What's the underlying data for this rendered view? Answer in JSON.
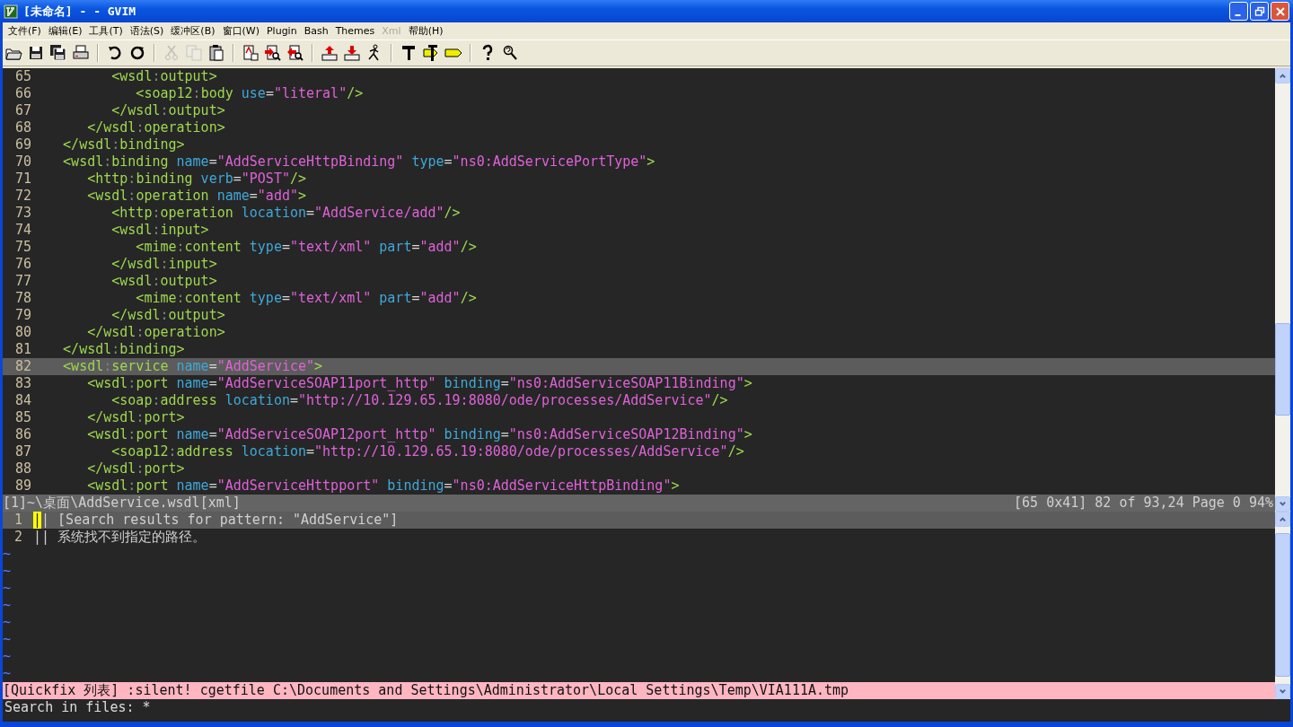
{
  "window": {
    "title": "[未命名] - - GVIM"
  },
  "menu": [
    {
      "label": "文件(F)",
      "disabled": false
    },
    {
      "label": "编辑(E)",
      "disabled": false
    },
    {
      "label": "工具(T)",
      "disabled": false
    },
    {
      "label": "语法(S)",
      "disabled": false
    },
    {
      "label": "缓冲区(B)",
      "disabled": false
    },
    {
      "label": "窗口(W)",
      "disabled": false
    },
    {
      "label": "Plugin",
      "disabled": false
    },
    {
      "label": "Bash",
      "disabled": false
    },
    {
      "label": "Themes",
      "disabled": false
    },
    {
      "label": "Xml",
      "disabled": true
    },
    {
      "label": "帮助(H)",
      "disabled": false
    }
  ],
  "toolbar": [
    {
      "kind": "folder",
      "disabled": false
    },
    {
      "kind": "floppy",
      "disabled": false
    },
    {
      "kind": "floppies",
      "disabled": false
    },
    {
      "kind": "printer",
      "disabled": false
    },
    {
      "kind": "sep"
    },
    {
      "kind": "undo",
      "disabled": false
    },
    {
      "kind": "redo",
      "disabled": false
    },
    {
      "kind": "sep"
    },
    {
      "kind": "scissors",
      "disabled": true
    },
    {
      "kind": "copy",
      "disabled": true
    },
    {
      "kind": "clipboard",
      "disabled": false
    },
    {
      "kind": "sep"
    },
    {
      "kind": "replace",
      "disabled": false
    },
    {
      "kind": "findnext",
      "disabled": false
    },
    {
      "kind": "findprev",
      "disabled": false
    },
    {
      "kind": "sep"
    },
    {
      "kind": "upload",
      "disabled": false
    },
    {
      "kind": "download",
      "disabled": false
    },
    {
      "kind": "runner",
      "disabled": false
    },
    {
      "kind": "sep"
    },
    {
      "kind": "hammer",
      "disabled": false
    },
    {
      "kind": "taghammer",
      "disabled": false
    },
    {
      "kind": "tag",
      "disabled": false
    },
    {
      "kind": "sep"
    },
    {
      "kind": "help",
      "disabled": false
    },
    {
      "kind": "findhelp",
      "disabled": false
    }
  ],
  "editor": {
    "lines": [
      {
        "num": "65",
        "current": false,
        "tokens": [
          {
            "kind": "tag",
            "t": "         <wsdl"
          },
          {
            "kind": "ns",
            "t": ":"
          },
          {
            "kind": "tag",
            "t": "output>"
          }
        ]
      },
      {
        "num": "66",
        "current": false,
        "tokens": [
          {
            "kind": "tag",
            "t": "            <soap12"
          },
          {
            "kind": "ns",
            "t": ":"
          },
          {
            "kind": "tag",
            "t": "body"
          },
          {
            "kind": "attr",
            "t": " use"
          },
          {
            "kind": "eq",
            "t": "="
          },
          {
            "kind": "str",
            "t": "\"literal\""
          },
          {
            "kind": "tag",
            "t": "/>"
          }
        ]
      },
      {
        "num": "67",
        "current": false,
        "tokens": [
          {
            "kind": "tag",
            "t": "         </wsdl"
          },
          {
            "kind": "ns",
            "t": ":"
          },
          {
            "kind": "tag",
            "t": "output>"
          }
        ]
      },
      {
        "num": "68",
        "current": false,
        "tokens": [
          {
            "kind": "tag",
            "t": "      </wsdl"
          },
          {
            "kind": "ns",
            "t": ":"
          },
          {
            "kind": "tag",
            "t": "operation>"
          }
        ]
      },
      {
        "num": "69",
        "current": false,
        "tokens": [
          {
            "kind": "tag",
            "t": "   </wsdl"
          },
          {
            "kind": "ns",
            "t": ":"
          },
          {
            "kind": "tag",
            "t": "binding>"
          }
        ]
      },
      {
        "num": "70",
        "current": false,
        "tokens": [
          {
            "kind": "tag",
            "t": "   <wsdl"
          },
          {
            "kind": "ns",
            "t": ":"
          },
          {
            "kind": "tag",
            "t": "binding"
          },
          {
            "kind": "attr",
            "t": " name"
          },
          {
            "kind": "eq",
            "t": "="
          },
          {
            "kind": "str",
            "t": "\"AddServiceHttpBinding\""
          },
          {
            "kind": "attr",
            "t": " type"
          },
          {
            "kind": "eq",
            "t": "="
          },
          {
            "kind": "str",
            "t": "\"ns0:AddServicePortType\""
          },
          {
            "kind": "tag",
            "t": ">"
          }
        ]
      },
      {
        "num": "71",
        "current": false,
        "tokens": [
          {
            "kind": "tag",
            "t": "      <http"
          },
          {
            "kind": "ns",
            "t": ":"
          },
          {
            "kind": "tag",
            "t": "binding"
          },
          {
            "kind": "attr",
            "t": " verb"
          },
          {
            "kind": "eq",
            "t": "="
          },
          {
            "kind": "str",
            "t": "\"POST\""
          },
          {
            "kind": "tag",
            "t": "/>"
          }
        ]
      },
      {
        "num": "72",
        "current": false,
        "tokens": [
          {
            "kind": "tag",
            "t": "      <wsdl"
          },
          {
            "kind": "ns",
            "t": ":"
          },
          {
            "kind": "tag",
            "t": "operation"
          },
          {
            "kind": "attr",
            "t": " name"
          },
          {
            "kind": "eq",
            "t": "="
          },
          {
            "kind": "str",
            "t": "\"add\""
          },
          {
            "kind": "tag",
            "t": ">"
          }
        ]
      },
      {
        "num": "73",
        "current": false,
        "tokens": [
          {
            "kind": "tag",
            "t": "         <http"
          },
          {
            "kind": "ns",
            "t": ":"
          },
          {
            "kind": "tag",
            "t": "operation"
          },
          {
            "kind": "attr",
            "t": " location"
          },
          {
            "kind": "eq",
            "t": "="
          },
          {
            "kind": "str",
            "t": "\"AddService/add\""
          },
          {
            "kind": "tag",
            "t": "/>"
          }
        ]
      },
      {
        "num": "74",
        "current": false,
        "tokens": [
          {
            "kind": "tag",
            "t": "         <wsdl"
          },
          {
            "kind": "ns",
            "t": ":"
          },
          {
            "kind": "tag",
            "t": "input>"
          }
        ]
      },
      {
        "num": "75",
        "current": false,
        "tokens": [
          {
            "kind": "tag",
            "t": "            <mime"
          },
          {
            "kind": "ns",
            "t": ":"
          },
          {
            "kind": "tag",
            "t": "content"
          },
          {
            "kind": "attr",
            "t": " type"
          },
          {
            "kind": "eq",
            "t": "="
          },
          {
            "kind": "str",
            "t": "\"text/xml\""
          },
          {
            "kind": "attr",
            "t": " part"
          },
          {
            "kind": "eq",
            "t": "="
          },
          {
            "kind": "str",
            "t": "\"add\""
          },
          {
            "kind": "tag",
            "t": "/>"
          }
        ]
      },
      {
        "num": "76",
        "current": false,
        "tokens": [
          {
            "kind": "tag",
            "t": "         </wsdl"
          },
          {
            "kind": "ns",
            "t": ":"
          },
          {
            "kind": "tag",
            "t": "input>"
          }
        ]
      },
      {
        "num": "77",
        "current": false,
        "tokens": [
          {
            "kind": "tag",
            "t": "         <wsdl"
          },
          {
            "kind": "ns",
            "t": ":"
          },
          {
            "kind": "tag",
            "t": "output>"
          }
        ]
      },
      {
        "num": "78",
        "current": false,
        "tokens": [
          {
            "kind": "tag",
            "t": "            <mime"
          },
          {
            "kind": "ns",
            "t": ":"
          },
          {
            "kind": "tag",
            "t": "content"
          },
          {
            "kind": "attr",
            "t": " type"
          },
          {
            "kind": "eq",
            "t": "="
          },
          {
            "kind": "str",
            "t": "\"text/xml\""
          },
          {
            "kind": "attr",
            "t": " part"
          },
          {
            "kind": "eq",
            "t": "="
          },
          {
            "kind": "str",
            "t": "\"add\""
          },
          {
            "kind": "tag",
            "t": "/>"
          }
        ]
      },
      {
        "num": "79",
        "current": false,
        "tokens": [
          {
            "kind": "tag",
            "t": "         </wsdl"
          },
          {
            "kind": "ns",
            "t": ":"
          },
          {
            "kind": "tag",
            "t": "output>"
          }
        ]
      },
      {
        "num": "80",
        "current": false,
        "tokens": [
          {
            "kind": "tag",
            "t": "      </wsdl"
          },
          {
            "kind": "ns",
            "t": ":"
          },
          {
            "kind": "tag",
            "t": "operation>"
          }
        ]
      },
      {
        "num": "81",
        "current": false,
        "tokens": [
          {
            "kind": "tag",
            "t": "   </wsdl"
          },
          {
            "kind": "ns",
            "t": ":"
          },
          {
            "kind": "tag",
            "t": "binding>"
          }
        ]
      },
      {
        "num": "82",
        "current": true,
        "tokens": [
          {
            "kind": "tag",
            "t": "   <wsdl"
          },
          {
            "kind": "ns",
            "t": ":"
          },
          {
            "kind": "tag",
            "t": "service"
          },
          {
            "kind": "attr",
            "t": " name"
          },
          {
            "kind": "eq",
            "t": "="
          },
          {
            "kind": "str",
            "t": "\"AddService\""
          },
          {
            "kind": "tag",
            "t": ">"
          }
        ]
      },
      {
        "num": "83",
        "current": false,
        "tokens": [
          {
            "kind": "tag",
            "t": "      <wsdl"
          },
          {
            "kind": "ns",
            "t": ":"
          },
          {
            "kind": "tag",
            "t": "port"
          },
          {
            "kind": "attr",
            "t": " name"
          },
          {
            "kind": "eq",
            "t": "="
          },
          {
            "kind": "str",
            "t": "\"AddServiceSOAP11port_http\""
          },
          {
            "kind": "attr",
            "t": " binding"
          },
          {
            "kind": "eq",
            "t": "="
          },
          {
            "kind": "str",
            "t": "\"ns0:AddServiceSOAP11Binding\""
          },
          {
            "kind": "tag",
            "t": ">"
          }
        ]
      },
      {
        "num": "84",
        "current": false,
        "tokens": [
          {
            "kind": "tag",
            "t": "         <soap"
          },
          {
            "kind": "ns",
            "t": ":"
          },
          {
            "kind": "tag",
            "t": "address"
          },
          {
            "kind": "attr",
            "t": " location"
          },
          {
            "kind": "eq",
            "t": "="
          },
          {
            "kind": "str",
            "t": "\"http://10.129.65.19:8080/ode/processes/AddService\""
          },
          {
            "kind": "tag",
            "t": "/>"
          }
        ]
      },
      {
        "num": "85",
        "current": false,
        "tokens": [
          {
            "kind": "tag",
            "t": "      </wsdl"
          },
          {
            "kind": "ns",
            "t": ":"
          },
          {
            "kind": "tag",
            "t": "port>"
          }
        ]
      },
      {
        "num": "86",
        "current": false,
        "tokens": [
          {
            "kind": "tag",
            "t": "      <wsdl"
          },
          {
            "kind": "ns",
            "t": ":"
          },
          {
            "kind": "tag",
            "t": "port"
          },
          {
            "kind": "attr",
            "t": " name"
          },
          {
            "kind": "eq",
            "t": "="
          },
          {
            "kind": "str",
            "t": "\"AddServiceSOAP12port_http\""
          },
          {
            "kind": "attr",
            "t": " binding"
          },
          {
            "kind": "eq",
            "t": "="
          },
          {
            "kind": "str",
            "t": "\"ns0:AddServiceSOAP12Binding\""
          },
          {
            "kind": "tag",
            "t": ">"
          }
        ]
      },
      {
        "num": "87",
        "current": false,
        "tokens": [
          {
            "kind": "tag",
            "t": "         <soap12"
          },
          {
            "kind": "ns",
            "t": ":"
          },
          {
            "kind": "tag",
            "t": "address"
          },
          {
            "kind": "attr",
            "t": " location"
          },
          {
            "kind": "eq",
            "t": "="
          },
          {
            "kind": "str",
            "t": "\"http://10.129.65.19:8080/ode/processes/AddService\""
          },
          {
            "kind": "tag",
            "t": "/>"
          }
        ]
      },
      {
        "num": "88",
        "current": false,
        "tokens": [
          {
            "kind": "tag",
            "t": "      </wsdl"
          },
          {
            "kind": "ns",
            "t": ":"
          },
          {
            "kind": "tag",
            "t": "port>"
          }
        ]
      },
      {
        "num": "89",
        "current": false,
        "tokens": [
          {
            "kind": "tag",
            "t": "      <wsdl"
          },
          {
            "kind": "ns",
            "t": ":"
          },
          {
            "kind": "tag",
            "t": "port"
          },
          {
            "kind": "attr",
            "t": " name"
          },
          {
            "kind": "eq",
            "t": "="
          },
          {
            "kind": "str",
            "t": "\"AddServiceHttpport\""
          },
          {
            "kind": "attr",
            "t": " binding"
          },
          {
            "kind": "eq",
            "t": "="
          },
          {
            "kind": "str",
            "t": "\"ns0:AddServiceHttpBinding\""
          },
          {
            "kind": "tag",
            "t": ">"
          }
        ]
      }
    ],
    "status_left": "[1]~\\桌面\\AddService.wsdl[xml]",
    "status_right": "[65 0x41] 82 of 93,24 Page 0 94%"
  },
  "quickfix": {
    "rows": [
      {
        "num": "1",
        "current": true,
        "cursor": "|",
        "marker": "|",
        "text": "[Search results for pattern: \"AddService\"]"
      },
      {
        "num": "2",
        "current": false,
        "marker": "||",
        "text": "系统找不到指定的路径。"
      }
    ],
    "tildes": [
      "~",
      "~",
      "~",
      "~",
      "~",
      "~",
      "~",
      "~"
    ],
    "status": "[Quickfix 列表] :silent! cgetfile C:\\Documents and Settings\\Administrator\\Local Settings\\Temp\\VIA111A.tmp"
  },
  "command_line": "Search in files: *"
}
